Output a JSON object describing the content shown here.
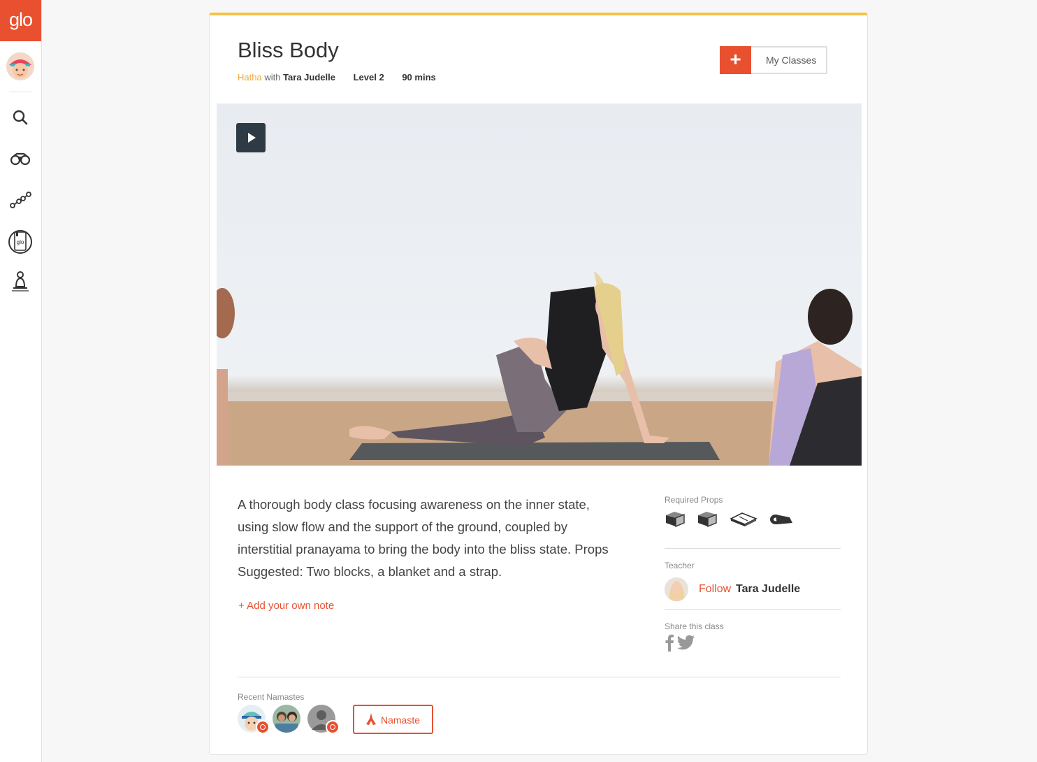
{
  "sidebar": {
    "logo": "glo",
    "nav_icons": [
      "search-icon",
      "binoculars-icon",
      "progress-path-icon",
      "glo-journal-icon",
      "meditation-icon"
    ]
  },
  "class": {
    "title": "Bliss Body",
    "style": "Hatha",
    "with_text": "with",
    "teacher": "Tara Judelle",
    "level": "Level 2",
    "duration": "90 mins"
  },
  "actions": {
    "add_icon": "+",
    "my_classes_label": "My Classes"
  },
  "description": "A thorough body class focusing awareness on the inner state, using slow flow and the support of the ground, coupled by interstitial pranayama to bring the body into the bliss state. Props Suggested: Two blocks, a blanket and a strap.",
  "add_note_label": "+ Add your own note",
  "props": {
    "label": "Required Props",
    "items": [
      "block-icon",
      "block-icon",
      "blanket-icon",
      "strap-icon"
    ]
  },
  "teacher_section": {
    "label": "Teacher",
    "follow_label": "Follow",
    "name": "Tara Judelle"
  },
  "share": {
    "label": "Share this class",
    "icons": [
      "facebook-icon",
      "twitter-icon"
    ]
  },
  "namastes": {
    "label": "Recent Namastes",
    "button_label": "Namaste"
  },
  "colors": {
    "brand": "#e8502f",
    "accent": "#f4c14a",
    "style_text": "#f0a93a"
  }
}
